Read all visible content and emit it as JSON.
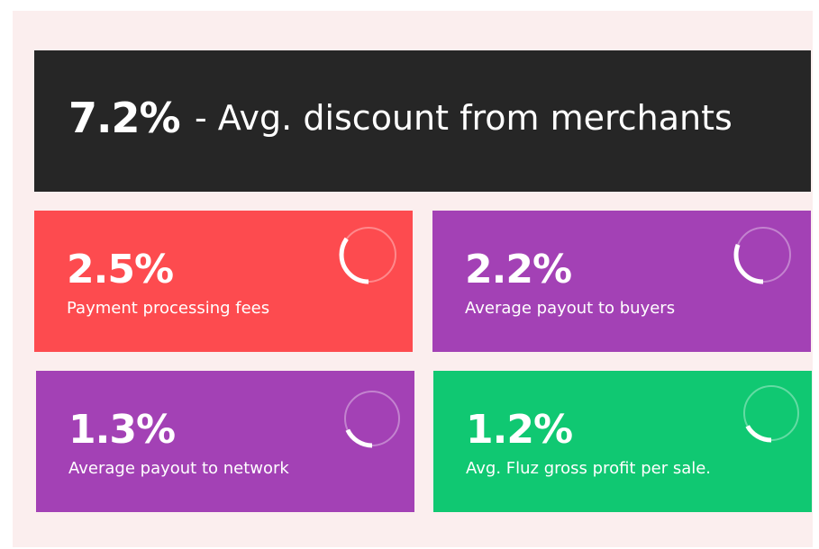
{
  "chart_data": {
    "type": "table",
    "headline": {
      "value": "7.2%",
      "label": "- Avg. discount from merchants"
    },
    "items": [
      {
        "value_label": "2.5%",
        "value": 2.5,
        "label": "Payment processing fees",
        "color": "#fd4b4f",
        "share_of_total": 0.35
      },
      {
        "value_label": "2.2%",
        "value": 2.2,
        "label": "Average payout to buyers",
        "color": "#a341b5",
        "share_of_total": 0.31
      },
      {
        "value_label": "1.3%",
        "value": 1.3,
        "label": "Average payout to network",
        "color": "#a341b5",
        "share_of_total": 0.18
      },
      {
        "value_label": "1.2%",
        "value": 1.2,
        "label": "Avg. Fluz gross profit per sale.",
        "color": "#10c872",
        "share_of_total": 0.17
      }
    ]
  },
  "colors": {
    "frame_background": "#fbeeee",
    "headline_background": "#262626",
    "text": "#ffffff"
  }
}
